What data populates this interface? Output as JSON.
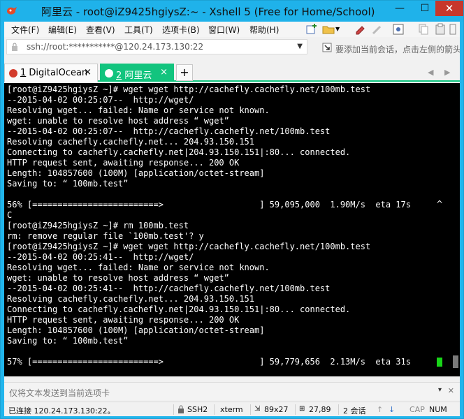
{
  "window": {
    "title": "阿里云 - root@iZ9425hgiysZ:~ - Xshell 5 (Free for Home/School)",
    "controls": {
      "minimize": "—",
      "maximize": "☐",
      "close": "✕"
    }
  },
  "menu": [
    "文件(F)",
    "编辑(E)",
    "查看(V)",
    "工具(T)",
    "选项卡(B)",
    "窗口(W)",
    "帮助(H)"
  ],
  "address": {
    "value": "ssh://root:***********@120.24.173.130:22"
  },
  "hint": "要添加当前会话，点击左侧的箭头",
  "tabs": [
    {
      "index": "1",
      "label": "DigitalOcean",
      "close": "×",
      "status_color": "#d33b2c"
    },
    {
      "index": "2",
      "label": "阿里云",
      "close": "×",
      "status_color": "#ffffff"
    }
  ],
  "tab_add": "+",
  "tab_nav": {
    "prev": "◀",
    "next": "▶"
  },
  "terminal": {
    "lines": [
      "[root@iZ9425hgiysZ ~]# wget wget http://cachefly.cachefly.net/100mb.test",
      "--2015-04-02 00:25:07--  http://wget/",
      "Resolving wget... failed: Name or service not known.",
      "wget: unable to resolve host address “ wget”",
      "--2015-04-02 00:25:07--  http://cachefly.cachefly.net/100mb.test",
      "Resolving cachefly.cachefly.net... 204.93.150.151",
      "Connecting to cachefly.cachefly.net|204.93.150.151|:80... connected.",
      "HTTP request sent, awaiting response... 200 OK",
      "Length: 104857600 (100M) [application/octet-stream]",
      "Saving to: “ 100mb.test”",
      "",
      "56% [=========================>                   ] 59,095,000  1.90M/s  eta 17s",
      "C",
      "[root@iZ9425hgiysZ ~]# rm 100mb.test",
      "rm: remove regular file `100mb.test'? y",
      "[root@iZ9425hgiysZ ~]# wget wget http://cachefly.cachefly.net/100mb.test",
      "--2015-04-02 00:25:41--  http://wget/",
      "Resolving wget... failed: Name or service not known.",
      "wget: unable to resolve host address “ wget”",
      "--2015-04-02 00:25:41--  http://cachefly.cachefly.net/100mb.test",
      "Resolving cachefly.cachefly.net... 204.93.150.151",
      "Connecting to cachefly.cachefly.net|204.93.150.151|:80... connected.",
      "HTTP request sent, awaiting response... 200 OK",
      "Length: 104857600 (100M) [application/octet-stream]",
      "Saving to: “ 100mb.test”",
      "",
      "57% [=========================>                   ] 59,779,656  2.13M/s  eta 31s"
    ],
    "scroll_glyph": "^",
    "cursor_color": "#18d418"
  },
  "input": {
    "placeholder": "仅将文本发送到当前选项卡",
    "drop": "▾",
    "close": "✕"
  },
  "status": {
    "connection": "已连接 120.24.173.130:22。",
    "protocol": "SSH2",
    "terminal_type": "xterm",
    "size": "89x27",
    "cursor_pos": "27,89",
    "sessions": "2 会话",
    "up_arrow": "↑",
    "down_arrow": "↓",
    "cap": "CAP",
    "num": "NUM"
  },
  "colors": {
    "titlebar": "#1fb2ea",
    "active_tab": "#12c47e",
    "close_button": "#c7372c",
    "terminal_bg": "#000000"
  }
}
